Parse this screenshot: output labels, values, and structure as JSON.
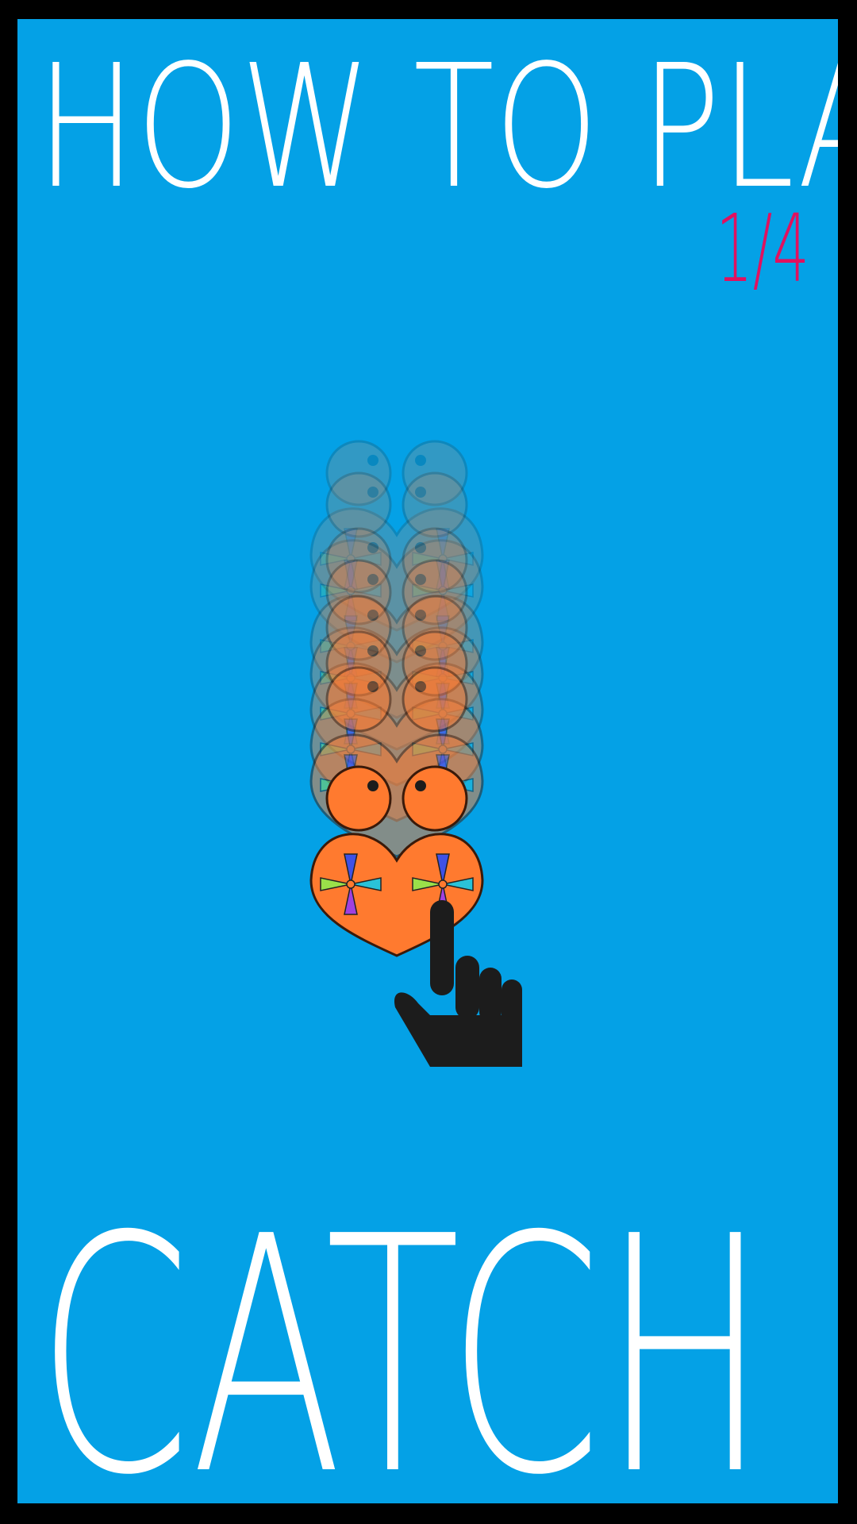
{
  "screen": {
    "title": "HOW TO PLAY",
    "page_indicator": "1/4",
    "instruction": "CATCH"
  },
  "colors": {
    "frame": "#000000",
    "background": "#04A1E6",
    "text": "#FFFFFF",
    "accent": "#E0115F",
    "creature_fill": "#FF7A2F",
    "creature_outline": "#3A1A0A",
    "hand": "#1C1C1C"
  },
  "icons": {
    "character": "frog-creature-icon",
    "motion_trail": "motion-trail",
    "pointer": "tap-hand-icon"
  }
}
